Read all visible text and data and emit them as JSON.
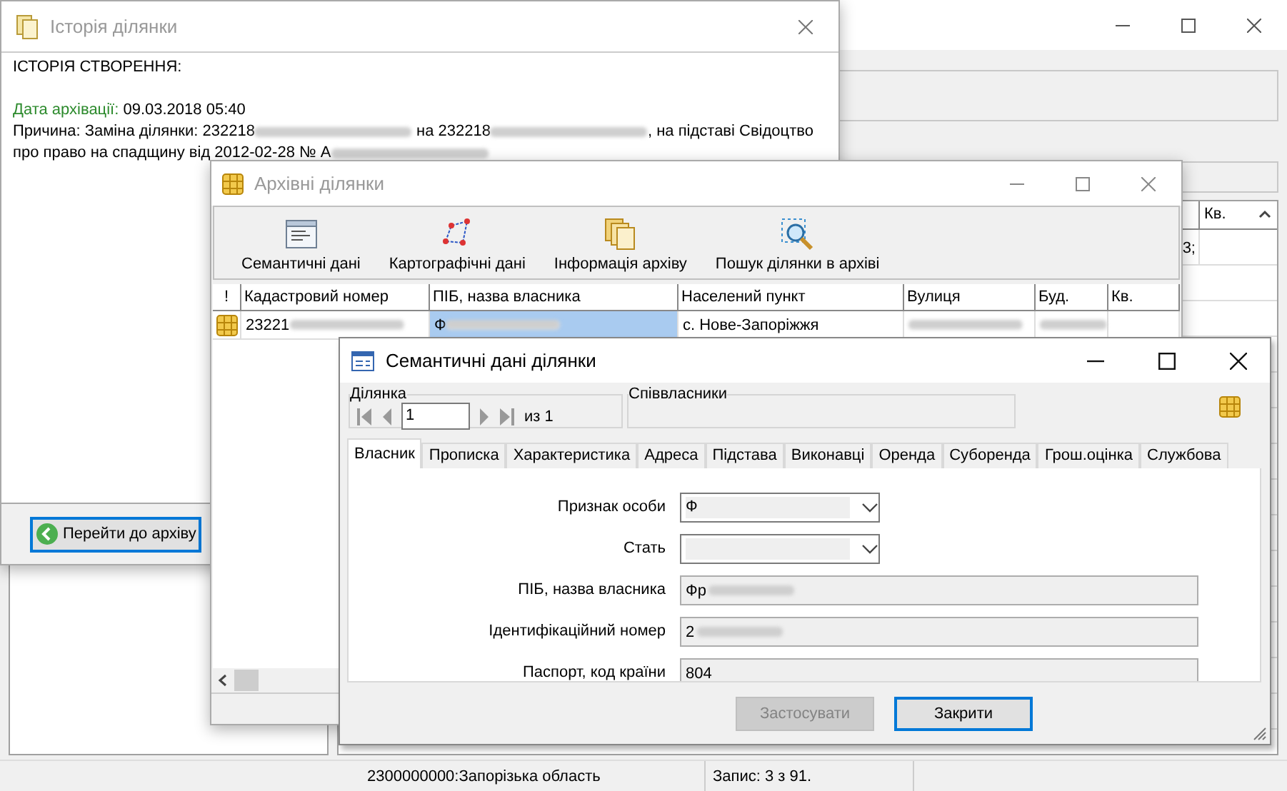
{
  "main_window": {
    "table": {
      "header": "Кв.",
      "rows": [
        {
          "cut_cell": "3;"
        }
      ]
    },
    "status_bar": {
      "region": "2300000000:Запорізька область",
      "record": "Запис: 3  з 91."
    }
  },
  "history_window": {
    "title": "Історія ділянки",
    "heading": "ІСТОРІЯ СТВОРЕННЯ:",
    "archive_date_label": "Дата архівації:",
    "archive_date": "09.03.2018 05:40",
    "reason": [
      {
        "text": "Причина: Заміна ділянки: 232218",
        "redacted": true
      },
      {
        "text": " на 232218",
        "redacted": true
      },
      {
        "text": ", на підставі Свідоцтво про право на спадщину від 2012-02-28 № А",
        "redacted": true
      }
    ],
    "button": {
      "label": "Перейти до архіву",
      "focused": true
    }
  },
  "archive_window": {
    "title": "Архівні ділянки",
    "toolbar": [
      "Семантичні дані",
      "Картографічні дані",
      "Інформація архіву",
      "Пошук ділянки в архіві"
    ],
    "table": {
      "columns": [
        "!",
        "Кадастровий номер",
        "ПІБ, назва власника",
        "Населений пункт",
        "Вулиця",
        "Буд.",
        "Кв."
      ],
      "rows": [
        {
          "cells": [
            {
              "selected": false
            },
            {
              "text": "23221",
              "redacted": true,
              "selected": false
            },
            {
              "text": "Ф",
              "redacted": true,
              "selected": true
            },
            {
              "text": "с. Нове-Запоріжжя",
              "selected": false
            },
            {
              "redacted": true,
              "selected": false
            },
            {
              "redacted": true,
              "selected": false
            },
            {
              "selected": false
            }
          ]
        }
      ]
    }
  },
  "semantic_dialog": {
    "title": "Семантичні дані ділянки",
    "parcel_group": {
      "label": "Ділянка",
      "value": "1",
      "count": "из 1"
    },
    "co_owners_group": {
      "label": "Співвласники"
    },
    "tabs": [
      {
        "label": "Власник",
        "selected": true
      },
      {
        "label": "Прописка",
        "selected": false
      },
      {
        "label": "Характеристика",
        "selected": false
      },
      {
        "label": "Адреса",
        "selected": false
      },
      {
        "label": "Підстава",
        "selected": false
      },
      {
        "label": "Виконавці",
        "selected": false
      },
      {
        "label": "Оренда",
        "selected": false
      },
      {
        "label": "Суборенда",
        "selected": false
      },
      {
        "label": "Грош.оцінка",
        "selected": false
      },
      {
        "label": "Службова",
        "selected": false
      }
    ],
    "fields": [
      {
        "label": "Признак особи",
        "kind": "select",
        "value": "Ф"
      },
      {
        "label": "Стать",
        "kind": "select"
      },
      {
        "label": "ПІБ, назва власника",
        "kind": "text",
        "value": "Фр",
        "redacted": true
      },
      {
        "label": "Ідентифікаційний номер",
        "kind": "text",
        "value": "2",
        "redacted": true
      },
      {
        "label": "Паспорт, код країни",
        "kind": "text",
        "value": "804"
      }
    ],
    "buttons": [
      {
        "label": "Застосувати",
        "disabled": true,
        "default": false
      },
      {
        "label": "Закрити",
        "disabled": false,
        "default": true
      }
    ]
  }
}
